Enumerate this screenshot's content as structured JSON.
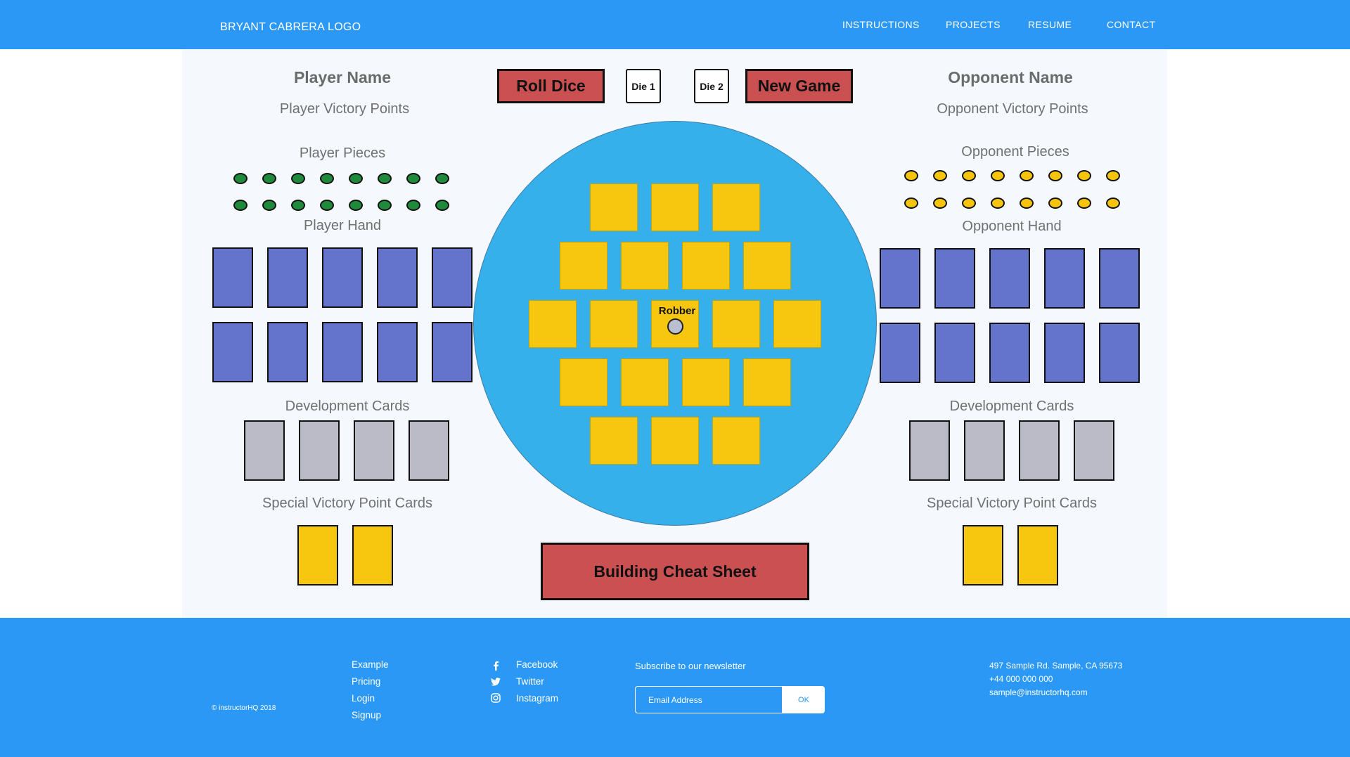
{
  "header": {
    "logo": "BRYANT CABRERA LOGO",
    "nav": [
      "INSTRUCTIONS",
      "PROJECTS",
      "RESUME",
      "CONTACT"
    ]
  },
  "player": {
    "name": "Player Name",
    "victory_points": "Player Victory Points",
    "pieces_label": "Player Pieces",
    "hand_label": "Player Hand",
    "dev_label": "Development Cards",
    "special_label": "Special Victory Point Cards"
  },
  "opponent": {
    "name": "Opponent Name",
    "victory_points": "Opponent Victory Points",
    "pieces_label": "Opponent Pieces",
    "hand_label": "Opponent Hand",
    "dev_label": "Development Cards",
    "special_label": "Special Victory Point Cards"
  },
  "controls": {
    "roll_dice": "Roll Dice",
    "die1": "Die 1",
    "die2": "Die 2",
    "new_game": "New Game",
    "cheat_sheet": "Building Cheat Sheet"
  },
  "board": {
    "robber_label": "Robber",
    "rows": [
      3,
      4,
      5,
      4,
      3
    ]
  },
  "footer": {
    "copyright": "© instructorHQ 2018",
    "links": [
      "Example",
      "Pricing",
      "Login",
      "Signup"
    ],
    "social": [
      {
        "label": "Facebook",
        "icon": "facebook-icon"
      },
      {
        "label": "Twitter",
        "icon": "twitter-icon"
      },
      {
        "label": "Instagram",
        "icon": "instagram-icon"
      }
    ],
    "newsletter_title": "Subscribe to our newsletter",
    "email_placeholder": "Email Address",
    "ok_label": "OK",
    "address": "497 Sample Rd. Sample, CA 95673",
    "phone": "+44 000 000 000",
    "email": "sample@instructorhq.com"
  },
  "colors": {
    "primary_blue": "#2b98f6",
    "board_blue": "#36b0ea",
    "tile_yellow": "#f6c70e",
    "card_blue": "#6474cc",
    "card_gray": "#babbc7",
    "button_red": "#ca5052",
    "piece_green": "#1f8a3c",
    "piece_yellow": "#f6c40a"
  }
}
